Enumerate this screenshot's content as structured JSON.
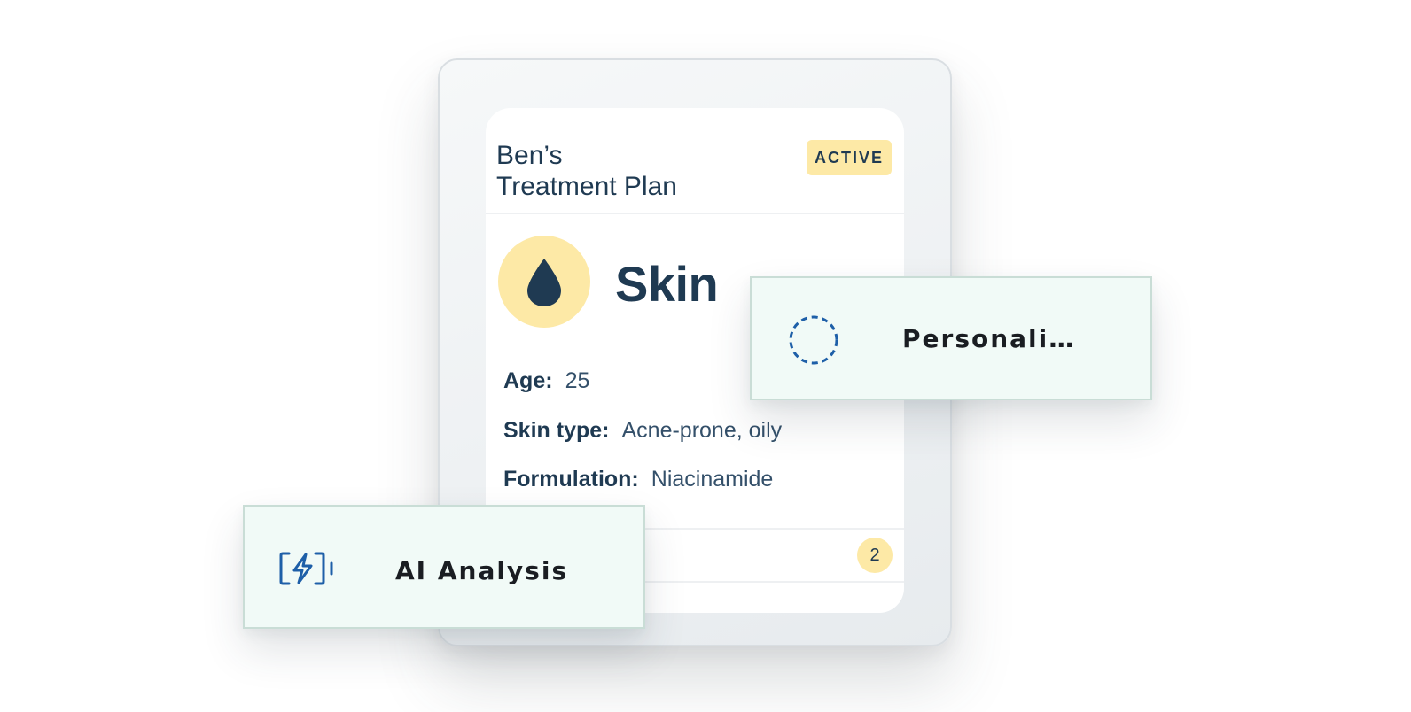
{
  "plan": {
    "title": "Ben’s\nTreatment Plan",
    "status": "ACTIVE"
  },
  "category": {
    "icon": "water-drop-icon",
    "name": "Skin"
  },
  "details": [
    {
      "label": "Age:",
      "value": "25"
    },
    {
      "label": "Skin type:",
      "value": "Acne-prone, oily"
    },
    {
      "label": "Formulation:",
      "value": "Niacinamide"
    }
  ],
  "footer": {
    "count": "2"
  },
  "float_cards": {
    "personalize": {
      "icon": "dashed-circle-icon",
      "label": "Personali…"
    },
    "ai": {
      "icon": "battery-bolt-icon",
      "label": "AI Analysis"
    }
  },
  "colors": {
    "navy": "#1f3a52",
    "yellow": "#fde9a6",
    "mint": "#f1faf7",
    "icon_blue": "#1e5fa8"
  }
}
